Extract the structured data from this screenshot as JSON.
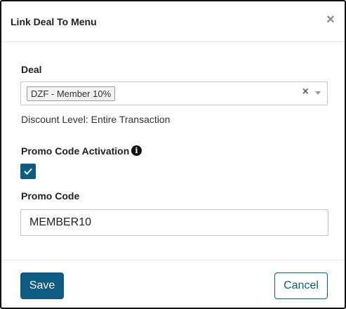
{
  "modal": {
    "title": "Link Deal To Menu",
    "close_icon": "close-icon"
  },
  "deal": {
    "label": "Deal",
    "selected_chip": "DZF - Member 10%",
    "clear_icon": "clear-icon",
    "dropdown_icon": "chevron-down-icon",
    "discount_level": "Discount Level: Entire Transaction"
  },
  "promo_activation": {
    "label": "Promo Code Activation",
    "info_icon": "info-icon",
    "checked": true
  },
  "promo_code": {
    "label": "Promo Code",
    "value": "MEMBER10"
  },
  "footer": {
    "save_label": "Save",
    "cancel_label": "Cancel"
  },
  "colors": {
    "primary": "#0e5c86",
    "border": "#c9c9c9"
  }
}
